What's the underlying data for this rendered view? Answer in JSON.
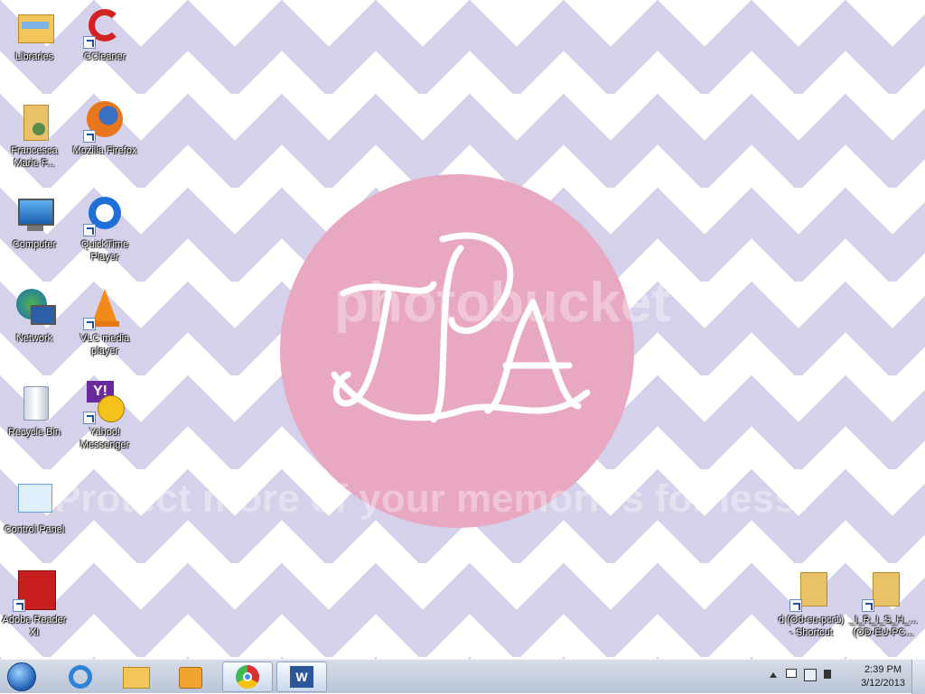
{
  "desktop": {
    "icons": [
      {
        "label": "Libraries",
        "icon": "libraries-icon"
      },
      {
        "label": "CCleaner",
        "icon": "ccleaner-icon"
      },
      {
        "label": "Francesca Marie F...",
        "icon": "user-folder-icon"
      },
      {
        "label": "Mozilla Firefox",
        "icon": "firefox-icon"
      },
      {
        "label": "Computer",
        "icon": "computer-icon"
      },
      {
        "label": "QuickTime Player",
        "icon": "quicktime-icon"
      },
      {
        "label": "Network",
        "icon": "network-icon"
      },
      {
        "label": "VLC media player",
        "icon": "vlc-icon"
      },
      {
        "label": "Recycle Bin",
        "icon": "recycle-bin-icon"
      },
      {
        "label": "Yahoo! Messenger",
        "icon": "yahoo-messenger-icon"
      },
      {
        "label": "Control Panel",
        "icon": "control-panel-icon"
      },
      {
        "label": "Adobe Reader XI",
        "icon": "adobe-reader-icon"
      },
      {
        "label": "d (Od-eu-pcr1) - Shortcut",
        "icon": "folder-shortcut-icon"
      },
      {
        "label": "_I_R_I_S_H_... (OD-EU-PC...",
        "icon": "folder-shortcut-icon"
      }
    ],
    "watermark_brand": "photobucket",
    "watermark_text": "Protect more of your memories for less!",
    "colors": {
      "chevron": "#d6d1ea",
      "circle": "#e8a8c2"
    }
  },
  "taskbar": {
    "pinned": [
      "start-orb-icon",
      "internet-explorer-icon",
      "file-explorer-icon",
      "media-player-icon",
      "chrome-icon",
      "word-icon"
    ],
    "clock": {
      "time": "2:39 PM",
      "date": "3/12/2013"
    }
  }
}
